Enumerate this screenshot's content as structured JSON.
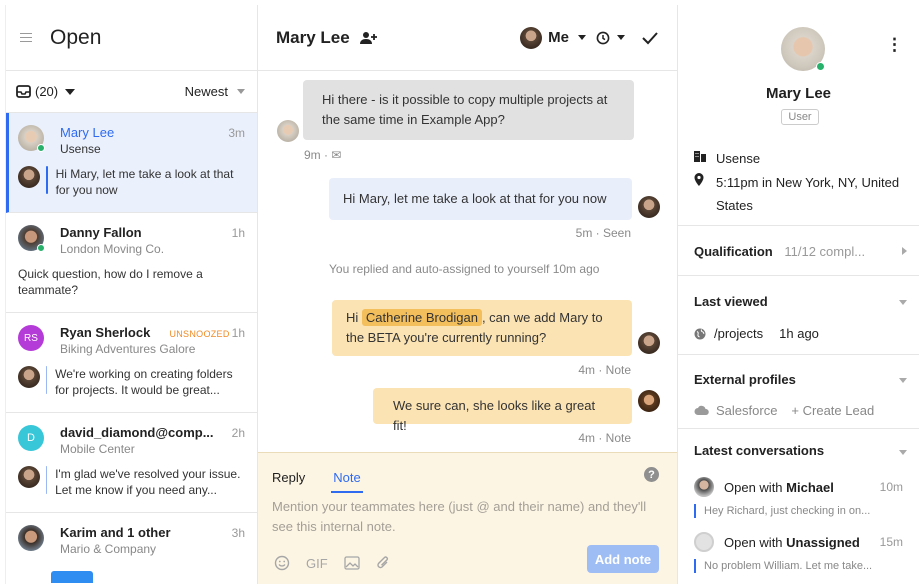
{
  "colors": {
    "accent": "#2f6bf0",
    "note_bg": "#fbe3b3",
    "online": "#27b16b",
    "unsnoozed": "#f08a24"
  },
  "left": {
    "title": "Open",
    "inbox_count": "(20)",
    "sort_label": "Newest",
    "conversations": [
      {
        "name": "Mary Lee",
        "time": "3m",
        "sub": "Usense",
        "preview": "Hi Mary, let me take a look at that for you now"
      },
      {
        "name": "Danny Fallon",
        "time": "1h",
        "sub": "London Moving Co.",
        "preview": "Quick question, how do I remove a teammate?"
      },
      {
        "name": "Ryan Sherlock",
        "badge": "UNSNOOZED",
        "time": "1h",
        "sub": "Biking Adventures Galore",
        "initials": "RS",
        "preview": "We're working on creating folders for projects. It would be great..."
      },
      {
        "name": "david_diamond@comp...",
        "time": "2h",
        "sub": "Mobile Center",
        "initials": "D",
        "preview": "I'm glad we've resolved your issue. Let me know if you need any..."
      },
      {
        "name": "Karim and 1 other",
        "time": "3h",
        "sub": "Mario & Company"
      }
    ]
  },
  "mid": {
    "title": "Mary Lee",
    "assignee": "Me",
    "messages": {
      "m1": "Hi there - is it possible to copy multiple projects at the same time in Example App?",
      "m1_meta": "9m · ✉",
      "m2": "Hi Mary, let me take a look at that for you now",
      "m2_meta": "5m · Seen",
      "event": "You replied and auto-assigned to yourself 10m ago",
      "m3_pre": "Hi",
      "m3_mention": "Catherine Brodigan",
      "m3_post": ", can we add Mary to the BETA you're currently running?",
      "m3_meta": "4m · Note",
      "m4": "We sure can, she looks like a great fit!",
      "m4_meta": "4m · Note"
    },
    "composer": {
      "tab_reply": "Reply",
      "tab_note": "Note",
      "placeholder": "Mention your teammates here (just @ and their name) and they'll see this internal note.",
      "gif": "GIF",
      "add_note": "Add note",
      "help": "?"
    }
  },
  "right": {
    "name": "Mary Lee",
    "role": "User",
    "company": "Usense",
    "location": "5:11pm in New York, NY, United States",
    "qualification_title": "Qualification",
    "qualification_value": "11/12 compl...",
    "last_viewed_title": "Last viewed",
    "last_viewed_page": "/projects",
    "last_viewed_time": "1h ago",
    "external_title": "External profiles",
    "salesforce": "Salesforce",
    "create_lead": "+ Create Lead",
    "latest_title": "Latest conversations",
    "latest": [
      {
        "prefix": "Open with ",
        "who": "Michael",
        "time": "10m",
        "preview": "Hey Richard, just checking in on..."
      },
      {
        "prefix": "Open with ",
        "who": "Unassigned",
        "time": "15m",
        "preview": "No problem William. Let me take..."
      }
    ]
  }
}
